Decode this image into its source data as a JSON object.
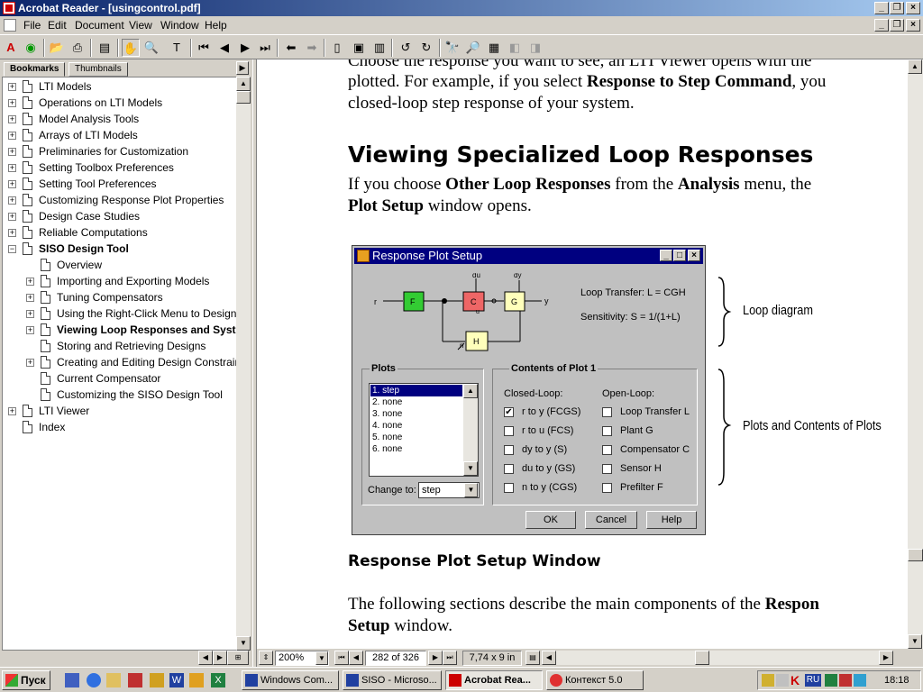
{
  "window": {
    "title": "Acrobat Reader - [usingcontrol.pdf]"
  },
  "menu": [
    "File",
    "Edit",
    "Document",
    "View",
    "Window",
    "Help"
  ],
  "nav_pane": {
    "tabs": [
      "Bookmarks",
      "Thumbnails"
    ],
    "tree": [
      {
        "label": "LTI Models",
        "level": 0,
        "expander": "+"
      },
      {
        "label": "Operations on LTI Models",
        "level": 0,
        "expander": "+"
      },
      {
        "label": "Model Analysis Tools",
        "level": 0,
        "expander": "+"
      },
      {
        "label": "Arrays of LTI Models",
        "level": 0,
        "expander": "+"
      },
      {
        "label": "Preliminaries for Customization",
        "level": 0,
        "expander": "+"
      },
      {
        "label": "Setting Toolbox Preferences",
        "level": 0,
        "expander": "+"
      },
      {
        "label": "Setting Tool Preferences",
        "level": 0,
        "expander": "+"
      },
      {
        "label": "Customizing Response Plot Properties",
        "level": 0,
        "expander": "+"
      },
      {
        "label": "Design Case Studies",
        "level": 0,
        "expander": "+"
      },
      {
        "label": "Reliable Computations",
        "level": 0,
        "expander": "+"
      },
      {
        "label": "SISO Design Tool",
        "level": 0,
        "expander": "-",
        "bold": true
      },
      {
        "label": "Overview",
        "level": 1,
        "expander": ""
      },
      {
        "label": "Importing and Exporting Models",
        "level": 1,
        "expander": "+"
      },
      {
        "label": "Tuning Compensators",
        "level": 1,
        "expander": "+"
      },
      {
        "label": "Using the Right-Click Menu to Design",
        "level": 1,
        "expander": "+"
      },
      {
        "label": "Viewing Loop Responses and System",
        "level": 1,
        "expander": "+",
        "bold": true
      },
      {
        "label": "Storing and Retrieving Designs",
        "level": 1,
        "expander": ""
      },
      {
        "label": "Creating and Editing Design Constraints",
        "level": 1,
        "expander": "+"
      },
      {
        "label": "Current Compensator",
        "level": 1,
        "expander": ""
      },
      {
        "label": "Customizing the SISO Design Tool",
        "level": 1,
        "expander": ""
      },
      {
        "label": "LTI Viewer",
        "level": 0,
        "expander": "+"
      },
      {
        "label": "Index",
        "level": 0,
        "expander": ""
      }
    ]
  },
  "document": {
    "para1_line1": "Choose the response you want to see, an LTI Viewer opens with the",
    "para1_line2_a": "plotted. For example, if you select ",
    "para1_line2_b": "Response to Step Command",
    "para1_line2_c": ", you",
    "para1_line3": "closed-loop step response of your system.",
    "heading": "Viewing Specialized Loop Responses",
    "para2_a": "If you choose ",
    "para2_b": "Other Loop Responses",
    "para2_c": " from the ",
    "para2_d": "Analysis",
    "para2_e": " menu, the",
    "para2_f": "Plot Setup",
    "para2_g": " window opens.",
    "caption": "Response Plot Setup Window",
    "para3_a": "The following sections describe the main components of the ",
    "para3_b": "Respon",
    "para3_c": "Setup",
    "para3_d": " window.",
    "callout_loop": "Loop diagram",
    "callout_plots": "Plots and Contents of Plots"
  },
  "dialog": {
    "title": "Response Plot Setup",
    "diagram": {
      "r": "r",
      "F": "F",
      "C": "C",
      "G": "G",
      "H": "H",
      "du": "du",
      "dy": "dy",
      "u": "u",
      "y": "y",
      "n": "n",
      "loop_transfer": "Loop Transfer:  L = CGH",
      "sensitivity": "Sensitivity:  S = 1/(1+L)"
    },
    "plots_group": "Plots",
    "plots": [
      "1. step",
      "2. none",
      "3. none",
      "4. none",
      "5. none",
      "6. none"
    ],
    "change_to_label": "Change to:",
    "change_to_value": "step",
    "contents_group": "Contents of Plot 1",
    "closed_loop_label": "Closed-Loop:",
    "open_loop_label": "Open-Loop:",
    "closed_loop": [
      {
        "label": "r to y  (FCGS)",
        "checked": true
      },
      {
        "label": "r to u  (FCS)",
        "checked": false
      },
      {
        "label": "dy to y  (S)",
        "checked": false
      },
      {
        "label": "du to y  (GS)",
        "checked": false
      },
      {
        "label": "n to y  (CGS)",
        "checked": false
      }
    ],
    "open_loop": [
      {
        "label": "Loop Transfer L",
        "checked": false
      },
      {
        "label": "Plant G",
        "checked": false
      },
      {
        "label": "Compensator C",
        "checked": false
      },
      {
        "label": "Sensor H",
        "checked": false
      },
      {
        "label": "Prefilter F",
        "checked": false
      }
    ],
    "buttons": {
      "ok": "OK",
      "cancel": "Cancel",
      "help": "Help"
    }
  },
  "statusbar": {
    "zoom": "200%",
    "page": "282 of 326",
    "size": "7,74 x 9 in"
  },
  "taskbar": {
    "start": "Пуск",
    "tasks": [
      "Windows Com...",
      "SISO - Microso...",
      "Acrobat Rea...",
      "Контекст 5.0"
    ],
    "lang": "RU",
    "clock": "18:18"
  },
  "colors": {
    "title_gradient_start": "#0a246a",
    "title_gradient_end": "#a6caf0",
    "block_F": "#33cc33",
    "block_C": "#ee6666",
    "block_G": "#ffffbb",
    "block_H": "#ffffbb",
    "dialog_title": "#000080"
  }
}
